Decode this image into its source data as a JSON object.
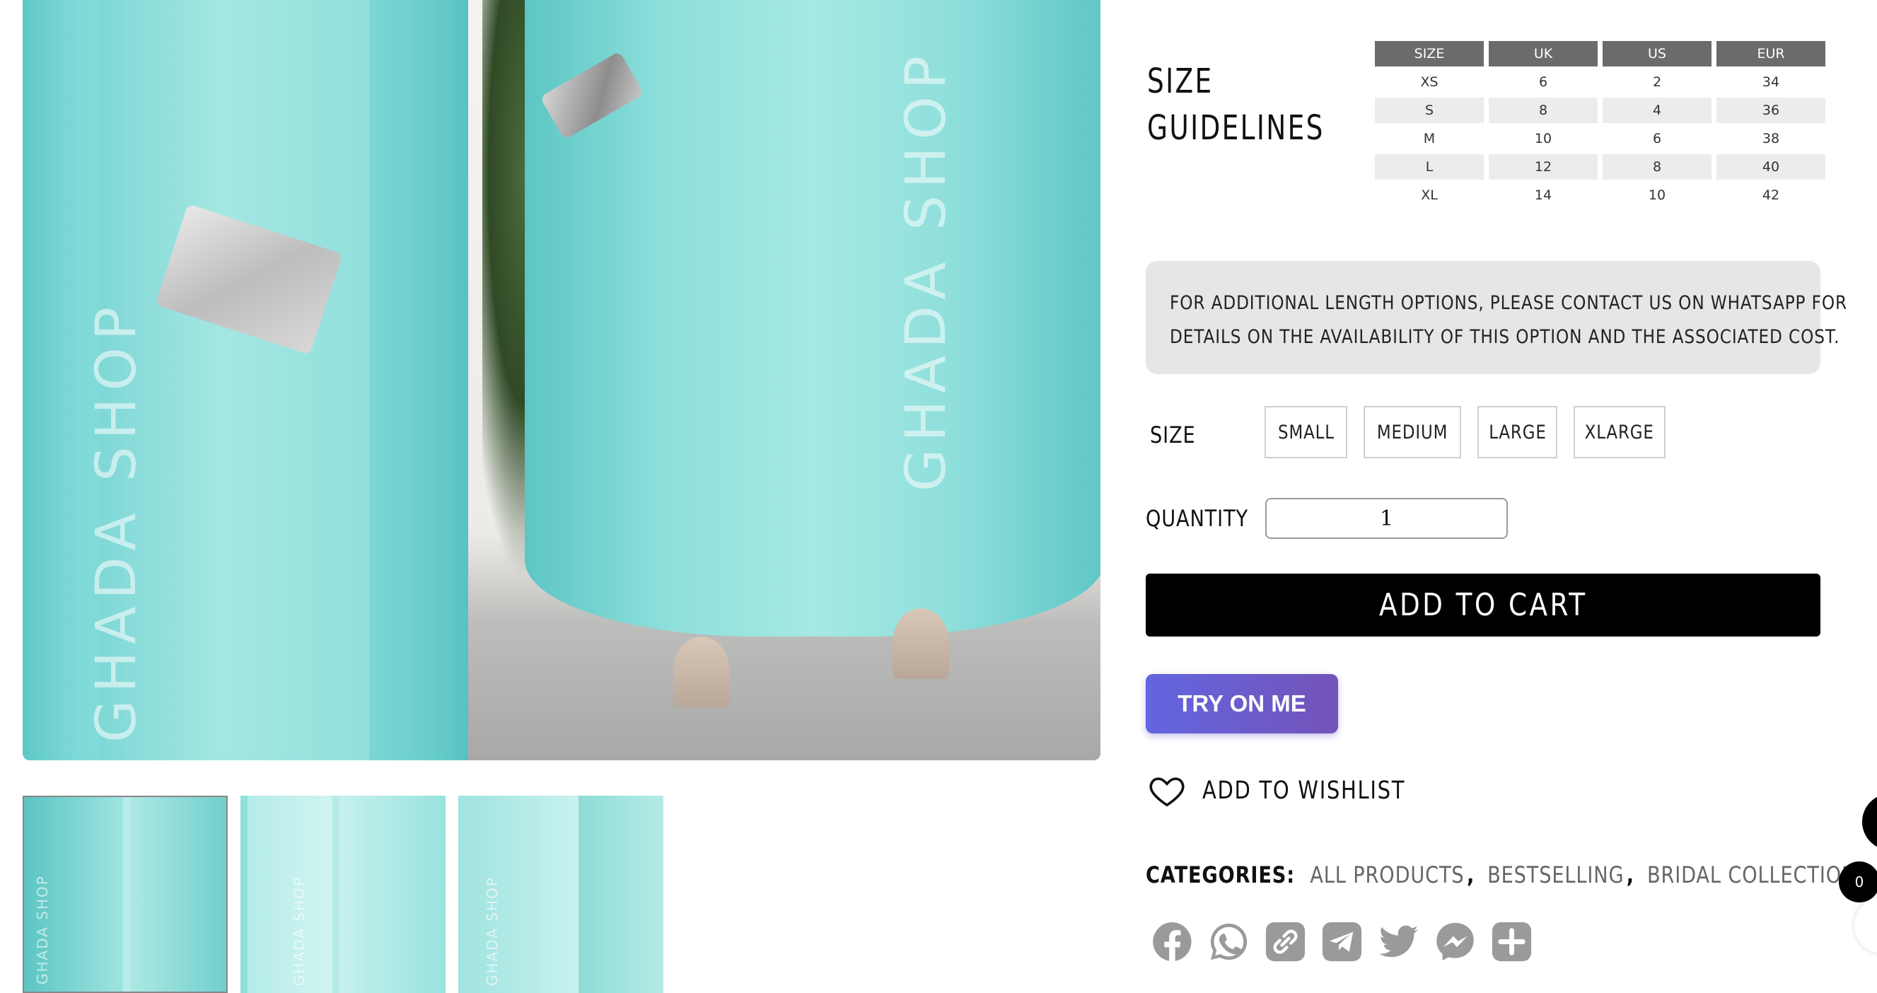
{
  "gallery": {
    "watermark": "GHADA SHOP",
    "thumbnail_count": 3
  },
  "size_guide": {
    "title_line1": "SIZE",
    "title_line2": "GUIDELINES",
    "headers": [
      "SIZE",
      "UK",
      "US",
      "EUR"
    ],
    "rows": [
      [
        "XS",
        "6",
        "2",
        "34"
      ],
      [
        "S",
        "8",
        "4",
        "36"
      ],
      [
        "M",
        "10",
        "6",
        "38"
      ],
      [
        "L",
        "12",
        "8",
        "40"
      ],
      [
        "XL",
        "14",
        "10",
        "42"
      ]
    ]
  },
  "notice": {
    "line1": "FOR ADDITIONAL LENGTH OPTIONS, PLEASE CONTACT US ON WHATSAPP FOR",
    "line2": "DETAILS ON THE AVAILABILITY OF THIS OPTION AND THE ASSOCIATED COST."
  },
  "size_selector": {
    "label": "SIZE",
    "options": [
      "SMALL",
      "MEDIUM",
      "LARGE",
      "XLARGE"
    ]
  },
  "quantity": {
    "label": "QUANTITY",
    "value": "1"
  },
  "actions": {
    "add_to_cart": "ADD TO CART",
    "try_on": "TRY ON ME",
    "wishlist": "ADD TO WISHLIST"
  },
  "categories": {
    "label": "CATEGORIES:",
    "items": [
      "ALL PRODUCTS",
      "BESTSELLING",
      "BRIDAL COLLECTION"
    ]
  },
  "share": {
    "icons": [
      "facebook-icon",
      "whatsapp-icon",
      "copy-link-icon",
      "telegram-icon",
      "twitter-icon",
      "messenger-icon",
      "share-plus-icon"
    ]
  },
  "cart": {
    "count": "0"
  },
  "colors": {
    "accent_dress": "#8fe0dc",
    "cart_button": "#000000",
    "try_on_gradient_start": "#6366e0",
    "try_on_gradient_end": "#7353b8",
    "table_header": "#6b6b6b",
    "icon_gray": "#9a9a9a"
  }
}
